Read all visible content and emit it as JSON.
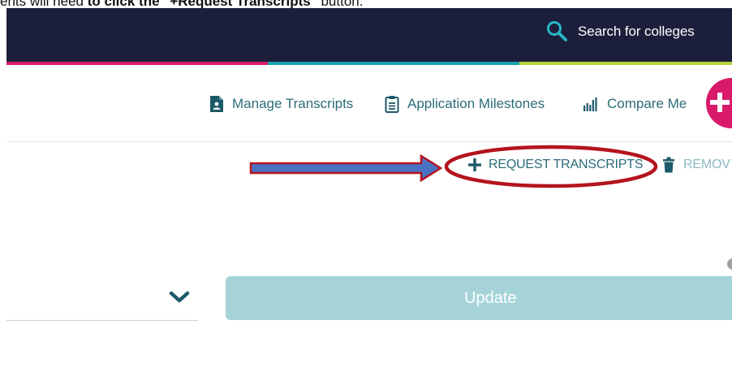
{
  "caption": {
    "prefix": "ents will need ",
    "bold_text": "to click the \"+Request Transcripts\"",
    "suffix": " button."
  },
  "header": {
    "search_label": "Search for colleges",
    "search_icon": "search-icon"
  },
  "nav": {
    "manage_transcripts": "Manage Transcripts",
    "application_milestones": "Application Milestones",
    "compare_me": "Compare Me"
  },
  "actions": {
    "request_transcripts": "REQUEST TRANSCRIPTS",
    "remove": "REMOV"
  },
  "form": {
    "update_label": "Update"
  },
  "colors": {
    "header_bg": "#1c1f3b",
    "accent_pink": "#d91a6b",
    "accent_teal": "#1a9fad",
    "accent_green": "#b7d43c",
    "link_teal": "#2b6c7a",
    "annotation_red": "#b4141e",
    "arrow_blue": "#4a72c4",
    "update_button": "#a5d3d8"
  }
}
